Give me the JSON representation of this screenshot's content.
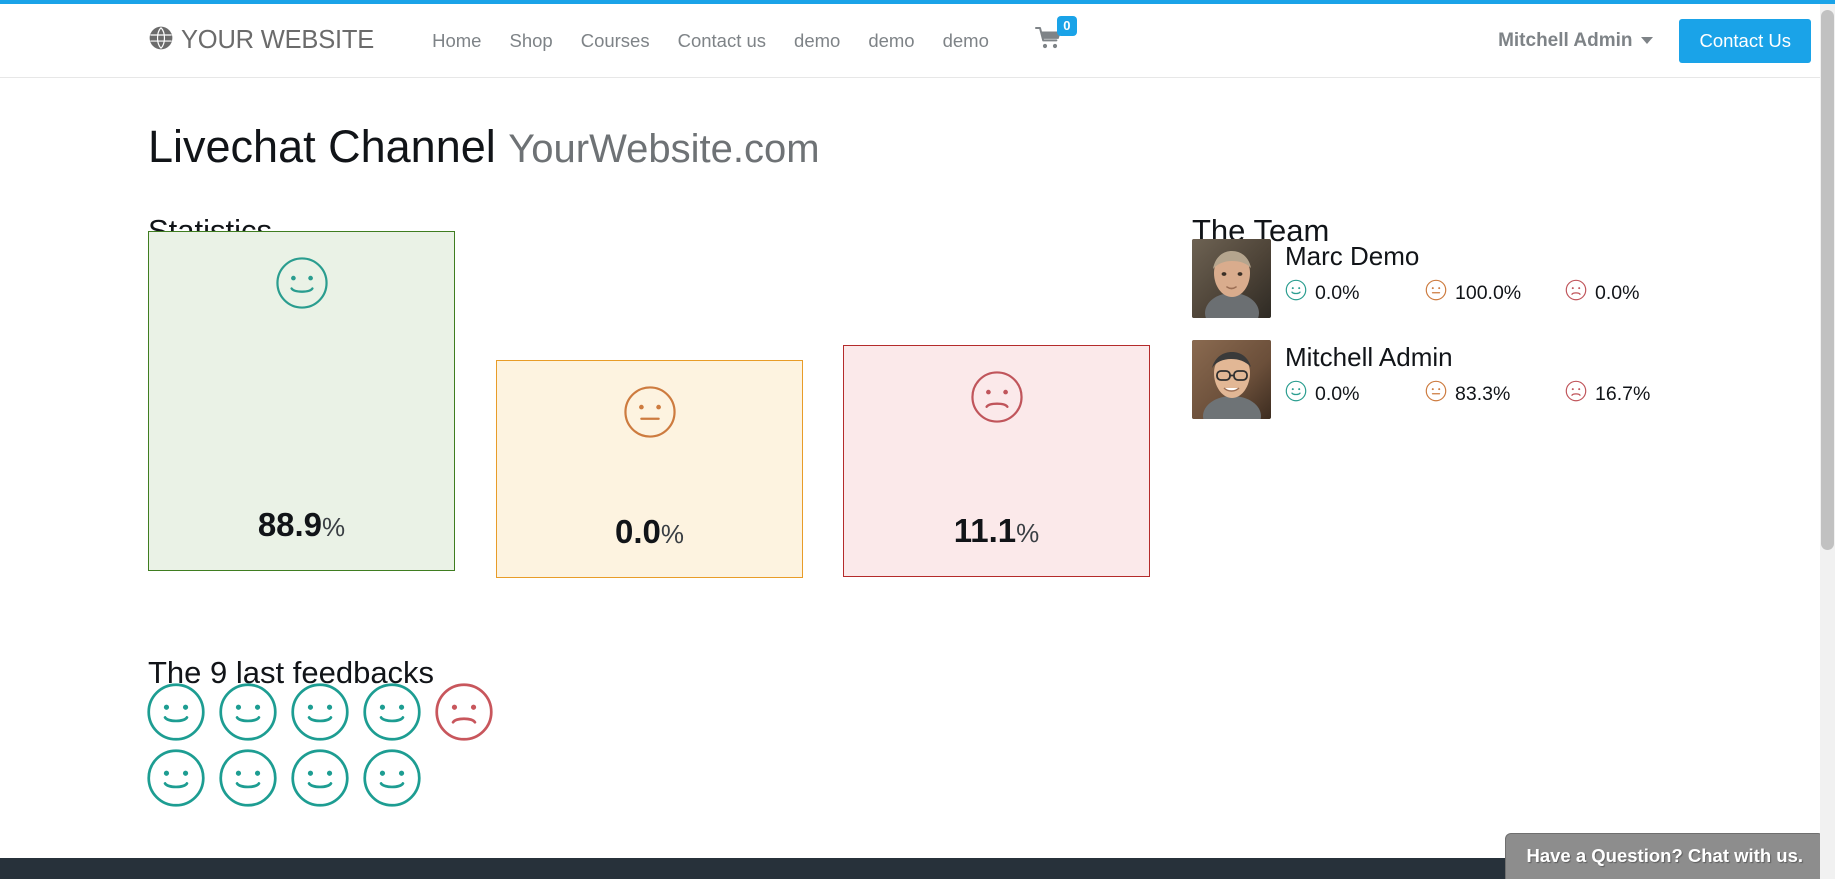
{
  "header": {
    "brand": "YOUR WEBSITE",
    "brand_icon": "globe-icon",
    "nav": [
      {
        "label": "Home"
      },
      {
        "label": "Shop"
      },
      {
        "label": "Courses"
      },
      {
        "label": "Contact us"
      },
      {
        "label": "demo"
      },
      {
        "label": "demo"
      },
      {
        "label": "demo"
      }
    ],
    "cart": {
      "icon": "shopping-cart-icon",
      "count": "0"
    },
    "user": {
      "name": "Mitchell Admin",
      "icon": "chevron-down-icon"
    },
    "cta": {
      "label": "Contact Us"
    },
    "accent_color": "#1aa3e8"
  },
  "page": {
    "title": "Livechat Channel",
    "subtitle": "YourWebsite.com"
  },
  "statistics": {
    "title": "Statistics",
    "boxes": [
      {
        "kind": "happy",
        "icon": "happy-face-icon",
        "value": "88.9",
        "unit": "%",
        "bg_color": "#eaf2e6",
        "border_color": "#3f7d20",
        "icon_color": "#2a9d8f"
      },
      {
        "kind": "neutral",
        "icon": "neutral-face-icon",
        "value": "0.0",
        "unit": "%",
        "bg_color": "#fdf3e0",
        "border_color": "#e89c28",
        "icon_color": "#cd7b3f"
      },
      {
        "kind": "sad",
        "icon": "sad-face-icon",
        "value": "11.1",
        "unit": "%",
        "bg_color": "#fbe9ea",
        "border_color": "#b42b2b",
        "icon_color": "#c0555b"
      }
    ]
  },
  "team": {
    "title": "The Team",
    "members": [
      {
        "name": "Marc Demo",
        "avatar": "marc-demo-avatar",
        "stats": [
          {
            "icon": "happy-face-icon",
            "value": "0.0%"
          },
          {
            "icon": "neutral-face-icon",
            "value": "100.0%"
          },
          {
            "icon": "sad-face-icon",
            "value": "0.0%"
          }
        ]
      },
      {
        "name": "Mitchell Admin",
        "avatar": "mitchell-admin-avatar",
        "stats": [
          {
            "icon": "happy-face-icon",
            "value": "0.0%"
          },
          {
            "icon": "neutral-face-icon",
            "value": "83.3%"
          },
          {
            "icon": "sad-face-icon",
            "value": "16.7%"
          }
        ]
      }
    ]
  },
  "feedbacks": {
    "title": "The 9 last feedbacks",
    "items": [
      {
        "kind": "happy"
      },
      {
        "kind": "happy"
      },
      {
        "kind": "happy"
      },
      {
        "kind": "happy"
      },
      {
        "kind": "sad"
      },
      {
        "kind": "happy"
      },
      {
        "kind": "happy"
      },
      {
        "kind": "happy"
      },
      {
        "kind": "happy"
      }
    ]
  },
  "chat_widget": {
    "label": "Have a Question? Chat with us."
  }
}
